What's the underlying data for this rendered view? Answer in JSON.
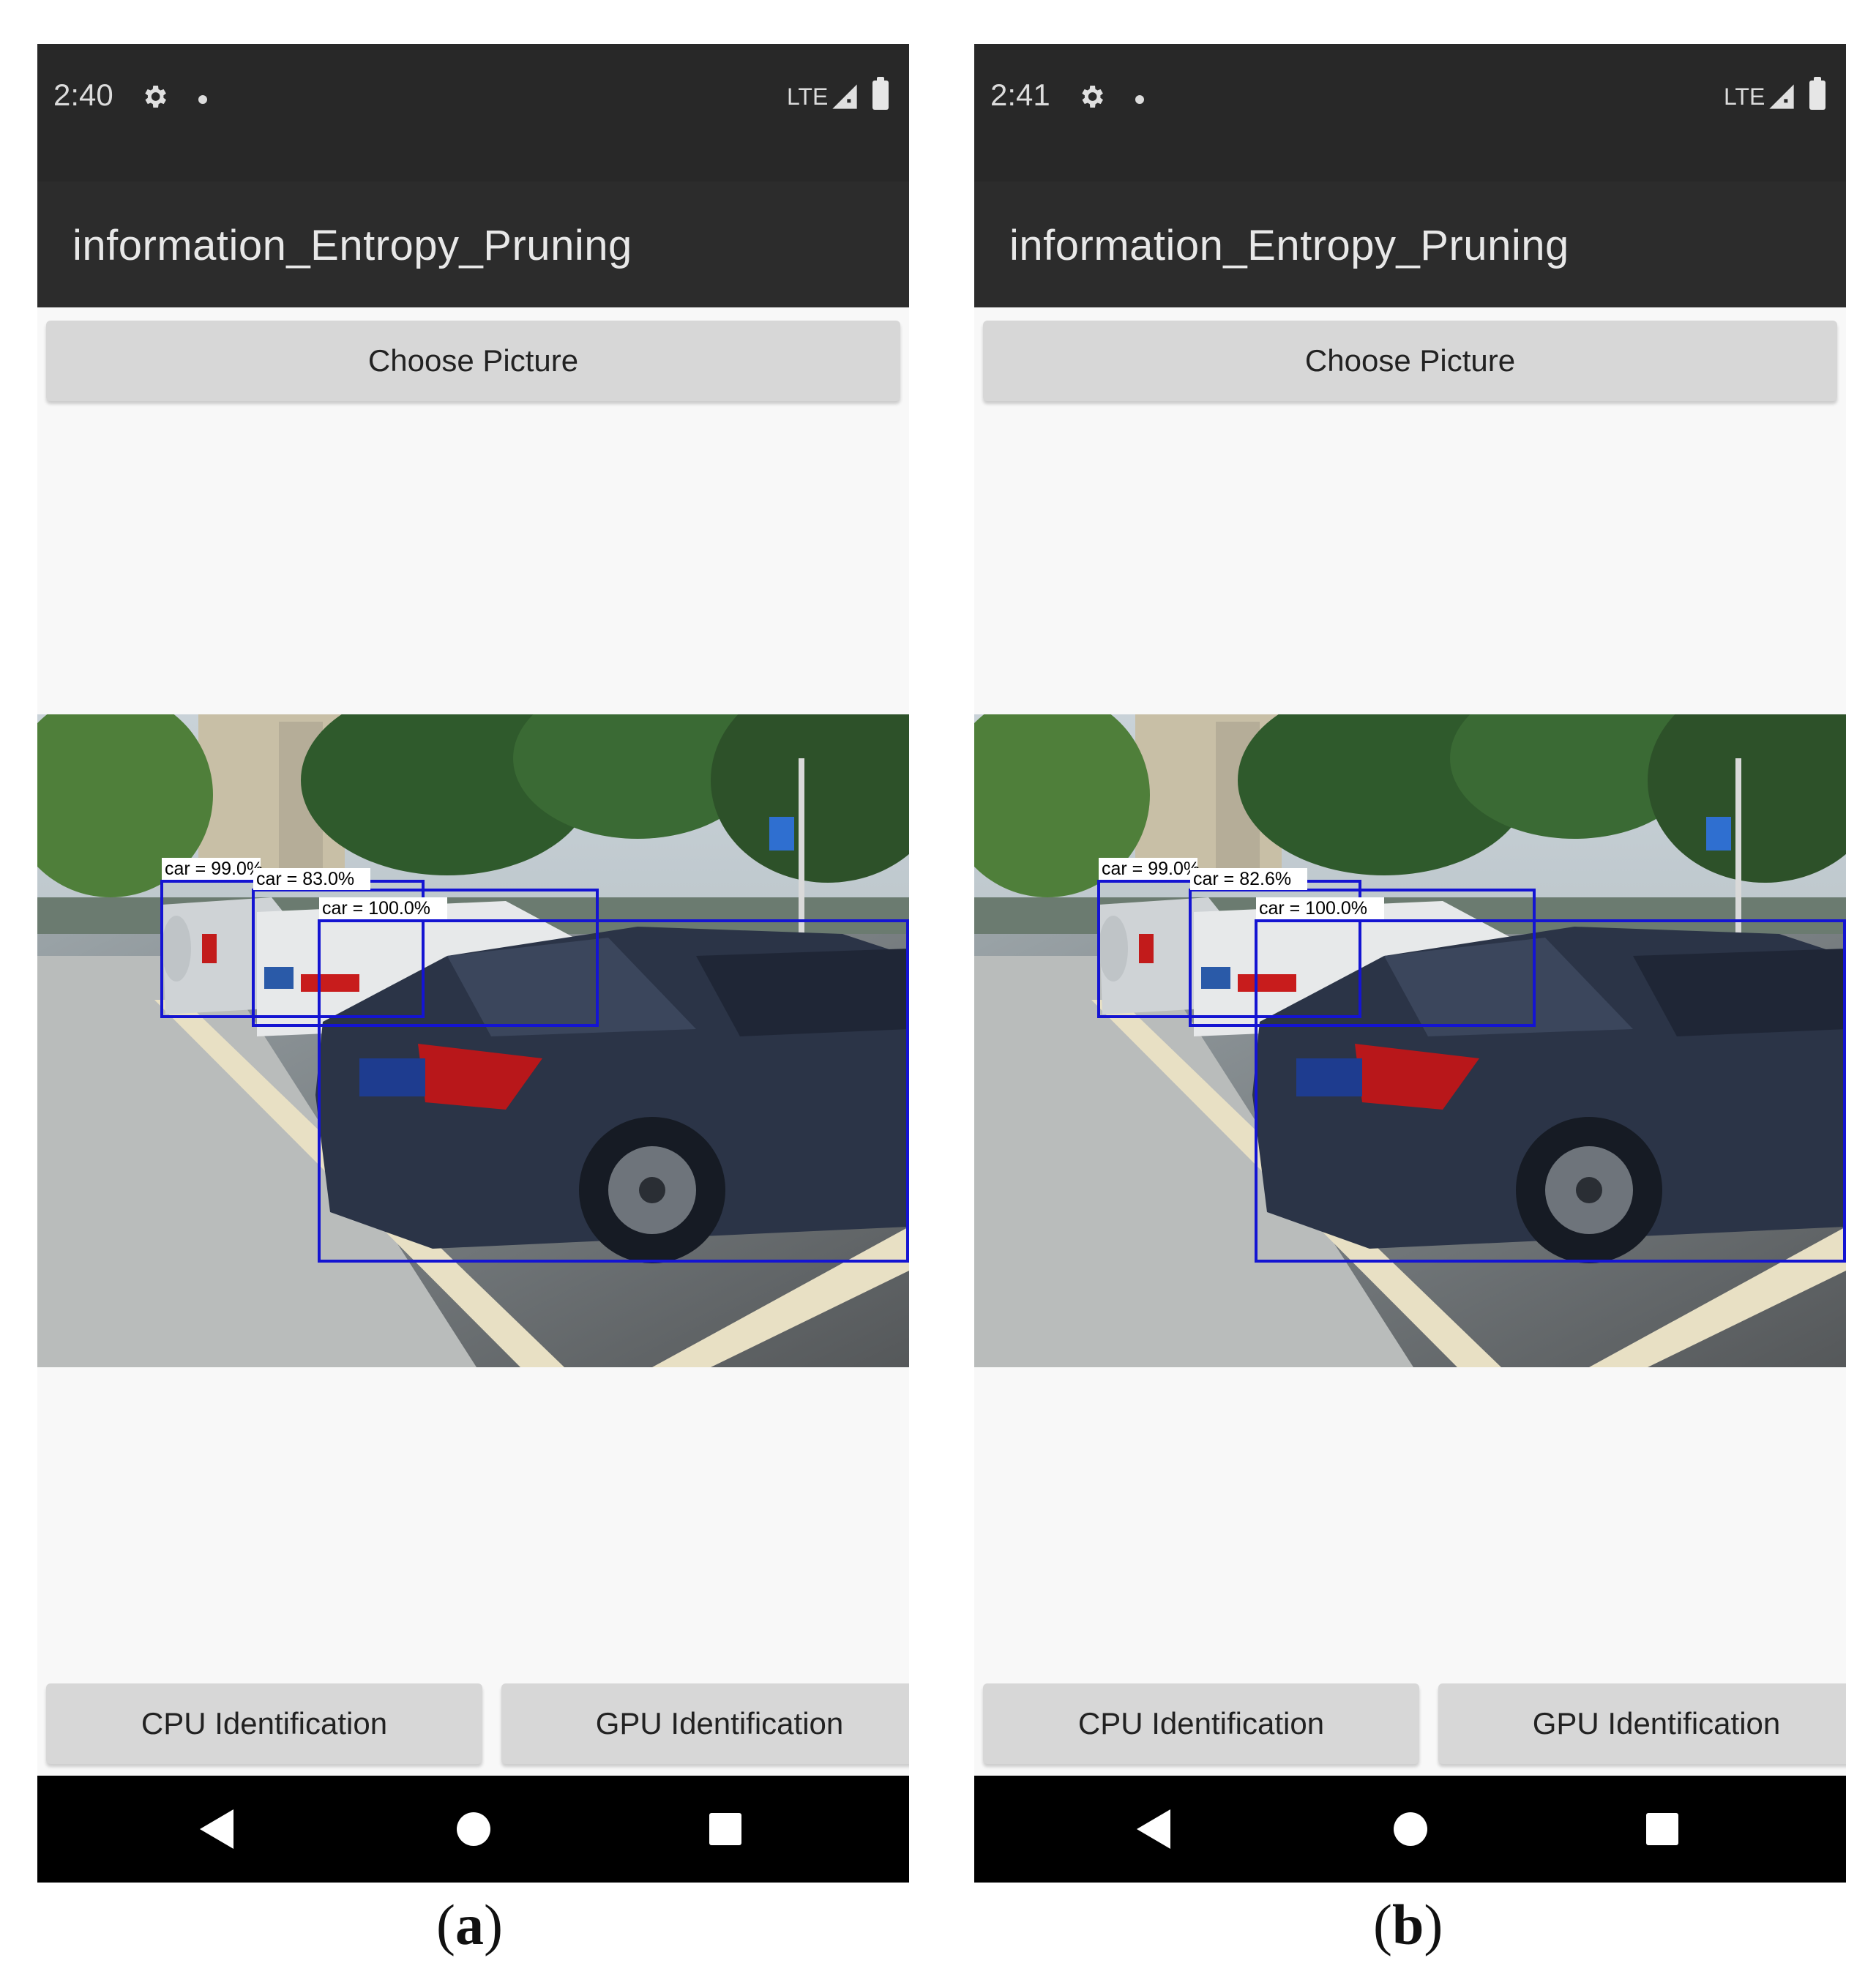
{
  "panels": [
    {
      "status_time": "2:40",
      "status_network": "LTE",
      "app_title": "information_Entropy_Pruning",
      "choose_button": "Choose Picture",
      "detections": [
        "car = 99.0%",
        "car = 83.0%",
        "car = 100.0%"
      ],
      "cpu_button": "CPU Identification",
      "gpu_button": "GPU Identification",
      "caption_open": "(",
      "caption_letter": "a",
      "caption_close": ")"
    },
    {
      "status_time": "2:41",
      "status_network": "LTE",
      "app_title": "information_Entropy_Pruning",
      "choose_button": "Choose Picture",
      "detections": [
        "car = 99.0%",
        "car = 82.6%",
        "car = 100.0%"
      ],
      "cpu_button": "CPU Identification",
      "gpu_button": "GPU Identification",
      "caption_open": "(",
      "caption_letter": "b",
      "caption_close": ")"
    }
  ],
  "colors": {
    "status_bar": "#282828",
    "app_bar": "#2c2c2c",
    "background": "#f8f8f8",
    "button": "#d7d7d7",
    "detection_box": "#1414d2",
    "nav_bar": "#000000"
  },
  "icons": [
    "gear-icon",
    "notification-dot-icon",
    "signal-icon",
    "battery-icon",
    "back-icon",
    "home-icon",
    "recents-icon"
  ]
}
